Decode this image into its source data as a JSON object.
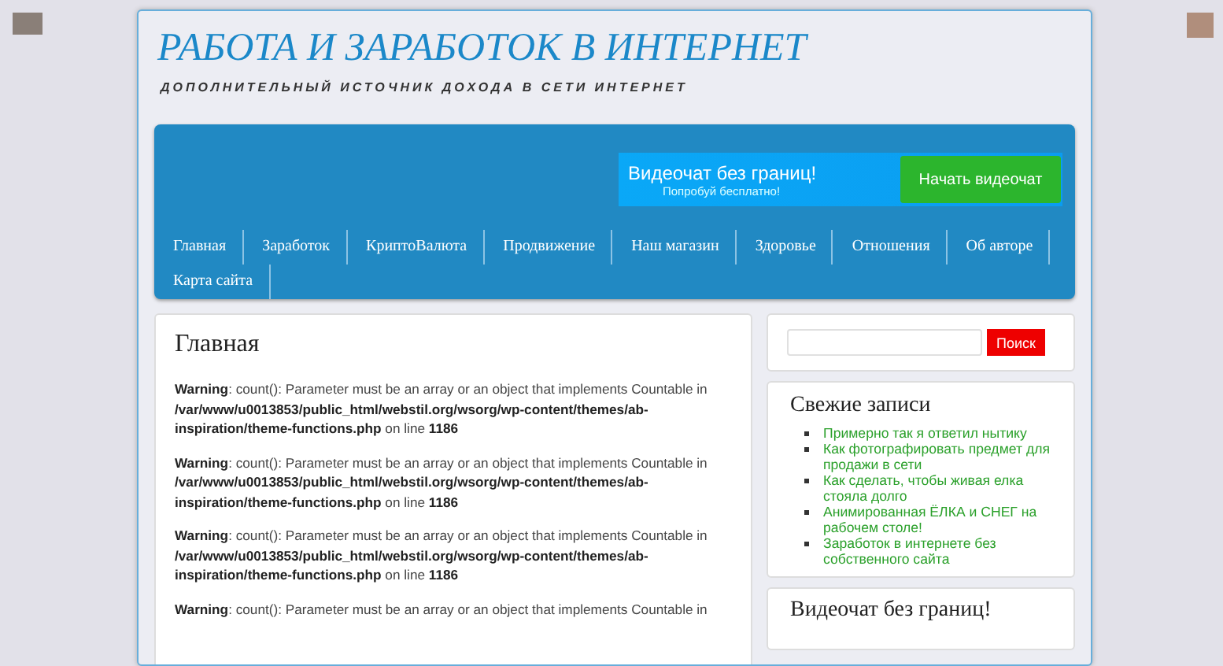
{
  "site": {
    "title": "РАБОТА И ЗАРАБОТОК В ИНТЕРНЕТ",
    "tagline": "ДОПОЛНИТЕЛЬНЫЙ ИСТОЧНИК ДОХОДА В СЕТИ ИНТЕРНЕТ"
  },
  "ad": {
    "headline": "Видеочат без границ!",
    "subline": "Попробуй бесплатно!",
    "button": "Начать видеочат"
  },
  "nav": [
    "Главная",
    "Заработок",
    "КриптоВалюта",
    "Продвижение",
    "Наш магазин",
    "Здоровье",
    "Отношения",
    "Об авторе",
    "Карта сайта"
  ],
  "main": {
    "title": "Главная",
    "warnings": [
      "**Warning**: count(): Parameter must be an array or an object that implements Countable in **/var/www/u0013853/public_html/webstil.org/wsorg/wp-content/themes/ab-inspiration/theme-functions.php** on line **1186**",
      "**Warning**: count(): Parameter must be an array or an object that implements Countable in **/var/www/u0013853/public_html/webstil.org/wsorg/wp-content/themes/ab-inspiration/theme-functions.php** on line **1186**",
      "**Warning**: count(): Parameter must be an array or an object that implements Countable in **/var/www/u0013853/public_html/webstil.org/wsorg/wp-content/themes/ab-inspiration/theme-functions.php** on line **1186**",
      "**Warning**: count(): Parameter must be an array or an object that implements Countable in"
    ]
  },
  "sidebar": {
    "search_button": "Поиск",
    "recent_title": "Свежие записи",
    "recent": [
      "Примерно так я ответил нытику",
      "Как фотографировать предмет для продажи в сети",
      "Как сделать, чтобы живая елка стояла долго",
      "Анимированная ЁЛКА и СНЕГ на рабочем столе!",
      "Заработок в интернете без собственного сайта"
    ],
    "widget_title": "Видеочат без границ!"
  }
}
